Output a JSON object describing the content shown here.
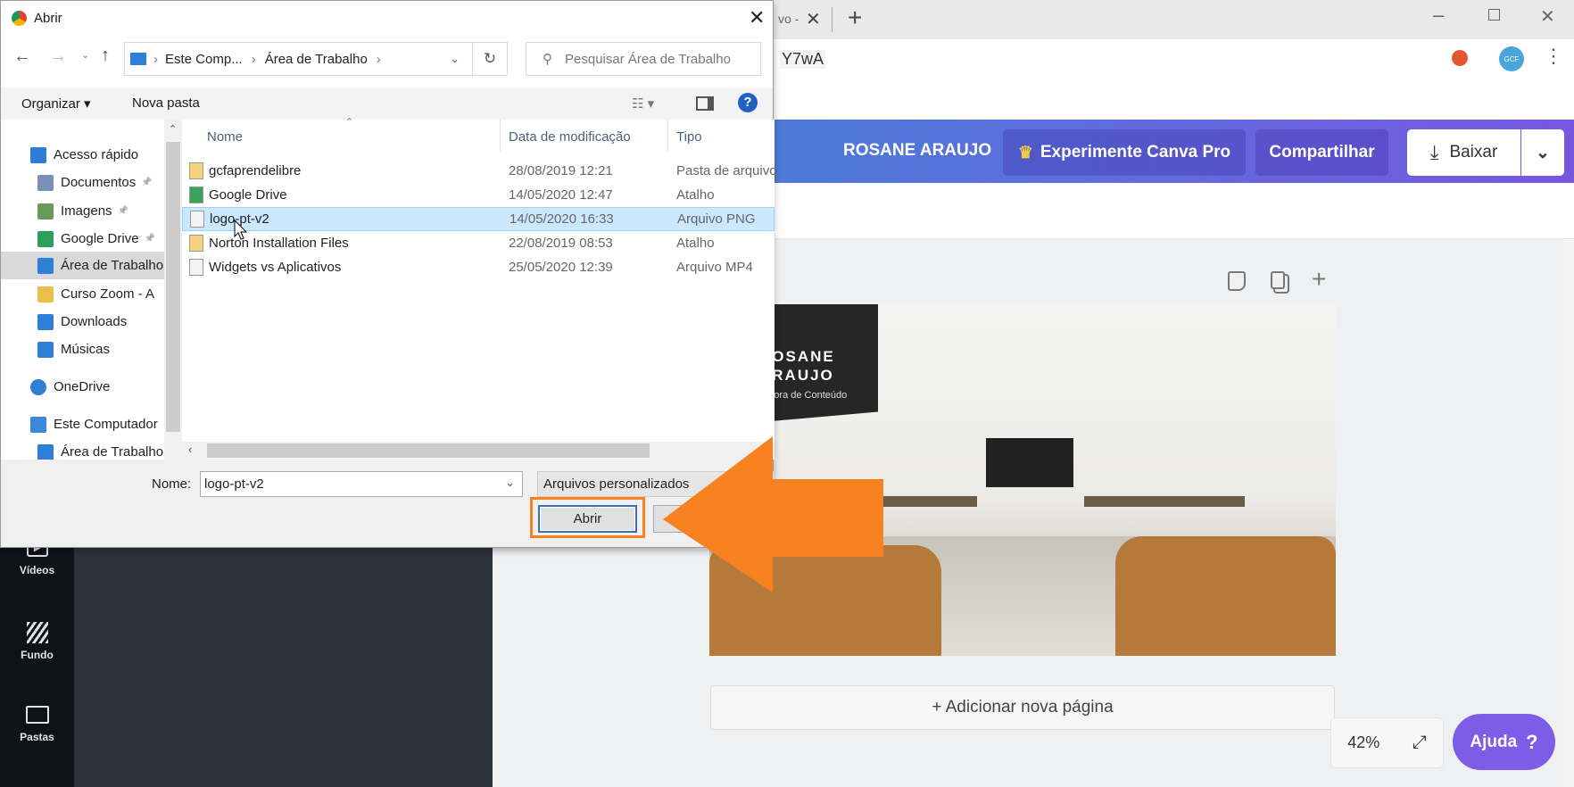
{
  "browser": {
    "tab_title_fragment": "vo -",
    "tab_close_icon": "close-icon",
    "new_tab_icon": "plus-icon",
    "url_fragment": "Y7wA",
    "window_controls": [
      "minimize-icon",
      "restore-icon",
      "close-icon"
    ],
    "toolbar_icons": [
      "star-icon",
      "extension-icon",
      "profile-avatar",
      "menu-icon"
    ],
    "avatar_text": "GCF"
  },
  "canva": {
    "user_name": "ROSANE ARAUJO",
    "pro_button": "Experimente Canva Pro",
    "share_button": "Compartilhar",
    "download_button": "Baixar",
    "sidebar": [
      {
        "label": "Vídeos",
        "icon": "video-icon"
      },
      {
        "label": "Fundo",
        "icon": "background-pattern-icon"
      },
      {
        "label": "Pastas",
        "icon": "folder-icon"
      }
    ],
    "page_tools": [
      "note-icon",
      "duplicate-icon",
      "plus-icon"
    ],
    "design_text": {
      "line1": "ROSANE",
      "line2": "ARAUJO",
      "line3": "Criadora de Conteúdo"
    },
    "add_page": "+ Adicionar nova página",
    "zoom_level": "42%",
    "help_button": "Ajuda",
    "help_icon": "?",
    "colors": {
      "header_start": "#3f86d4",
      "header_end": "#7857df",
      "help": "#7d5ce8",
      "highlight": "#f98220"
    }
  },
  "dialog": {
    "title": "Abrir",
    "breadcrumb": [
      "Este Comp...",
      "Área de Trabalho"
    ],
    "search_placeholder": "Pesquisar Área de Trabalho",
    "organize": "Organizar",
    "new_folder": "Nova pasta",
    "nav": [
      {
        "label": "Acesso rápido",
        "icon": "star-icon",
        "indent": false,
        "pinned": false
      },
      {
        "label": "Documentos",
        "icon": "documents-icon",
        "indent": true,
        "pinned": true
      },
      {
        "label": "Imagens",
        "icon": "images-icon",
        "indent": true,
        "pinned": true
      },
      {
        "label": "Google Drive",
        "icon": "google-drive-icon",
        "indent": true,
        "pinned": true
      },
      {
        "label": "Área de Trabalho",
        "icon": "desktop-icon",
        "indent": true,
        "pinned": false,
        "selected": true
      },
      {
        "label": "Curso Zoom - A",
        "icon": "folder-icon",
        "indent": true,
        "pinned": false
      },
      {
        "label": "Downloads",
        "icon": "download-icon",
        "indent": true,
        "pinned": false
      },
      {
        "label": "Músicas",
        "icon": "music-icon",
        "indent": true,
        "pinned": false
      },
      {
        "label": "OneDrive",
        "icon": "cloud-icon",
        "indent": false,
        "pinned": false
      },
      {
        "label": "Este Computador",
        "icon": "computer-icon",
        "indent": false,
        "pinned": false
      },
      {
        "label": "Área de Trabalho",
        "icon": "desktop-icon",
        "indent": true,
        "pinned": false
      }
    ],
    "columns": [
      "Nome",
      "Data de modificação",
      "Tipo"
    ],
    "files": [
      {
        "name": "gcfaprendelibre",
        "date": "28/08/2019 12:21",
        "type": "Pasta de arquivo",
        "icon": "folder-icon"
      },
      {
        "name": "Google Drive",
        "date": "14/05/2020 12:47",
        "type": "Atalho",
        "icon": "google-drive-icon"
      },
      {
        "name": "logo-pt-v2",
        "date": "14/05/2020 16:33",
        "type": "Arquivo PNG",
        "icon": "image-file-icon",
        "selected": true
      },
      {
        "name": "Norton Installation Files",
        "date": "22/08/2019 08:53",
        "type": "Atalho",
        "icon": "folder-icon"
      },
      {
        "name": "Widgets vs Aplicativos",
        "date": "25/05/2020 12:39",
        "type": "Arquivo MP4",
        "icon": "video-file-icon"
      }
    ],
    "name_label": "Nome:",
    "name_value": "logo-pt-v2",
    "file_filter": "Arquivos personalizados",
    "open_button": "Abrir"
  }
}
